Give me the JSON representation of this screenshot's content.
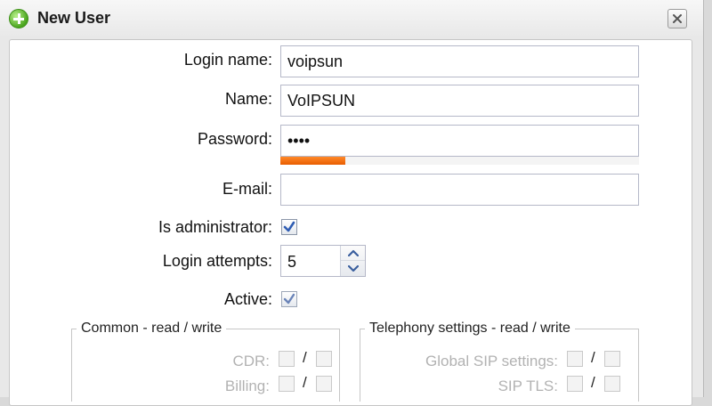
{
  "dialog": {
    "title": "New User"
  },
  "form": {
    "login_name": {
      "label": "Login name:",
      "value": "voipsun"
    },
    "name": {
      "label": "Name:",
      "value": "VoIPSUN"
    },
    "password": {
      "label": "Password:",
      "value": "••••",
      "strength_fraction": 0.18
    },
    "email": {
      "label": "E-mail:",
      "value": ""
    },
    "is_admin": {
      "label": "Is administrator:",
      "checked": true
    },
    "login_attempts": {
      "label": "Login attempts:",
      "value": "5"
    },
    "active": {
      "label": "Active:",
      "checked": true
    }
  },
  "groups": {
    "common": {
      "legend": "Common - read / write",
      "rows": [
        {
          "label": "CDR:",
          "read": false,
          "write": false
        },
        {
          "label": "Billing:",
          "read": false,
          "write": false
        }
      ]
    },
    "telephony": {
      "legend": "Telephony settings - read / write",
      "rows": [
        {
          "label": "Global SIP settings:",
          "read": false,
          "write": false
        },
        {
          "label": "SIP TLS:",
          "read": false,
          "write": false
        }
      ]
    },
    "separator": "/"
  },
  "colors": {
    "strength_bar": "#e85d00",
    "checkbox_tick": "#2f5db3",
    "title_icon": "#4aa51e"
  }
}
